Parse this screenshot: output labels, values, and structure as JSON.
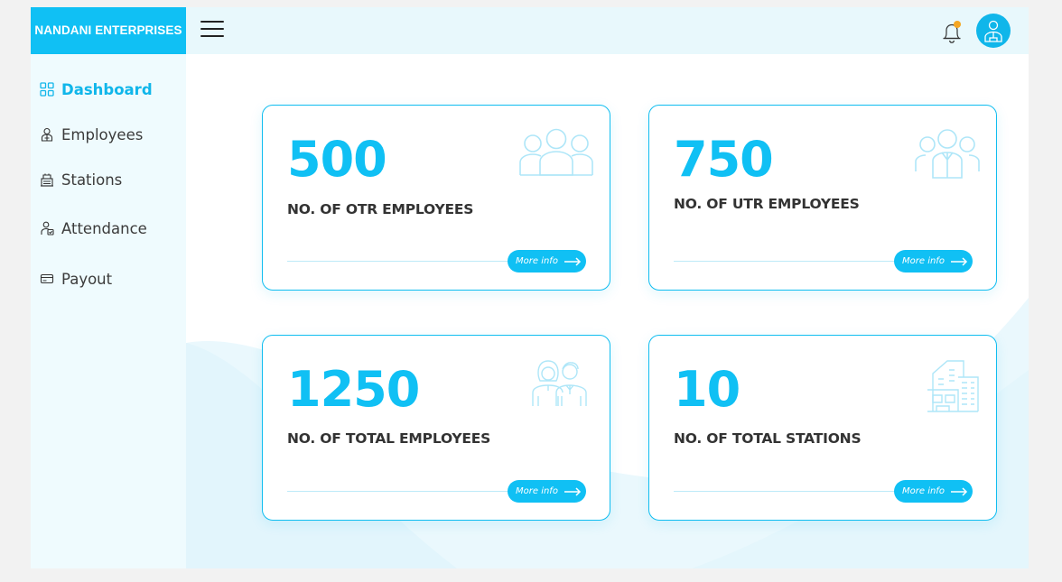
{
  "brand": {
    "name": "NANDANI ENTERPRISES"
  },
  "sidebar": {
    "items": [
      {
        "label": "Dashboard",
        "icon": "dashboard-grid-icon",
        "active": true
      },
      {
        "label": "Employees",
        "icon": "employee-icon",
        "active": false
      },
      {
        "label": "Stations",
        "icon": "station-icon",
        "active": false
      },
      {
        "label": "Attendance",
        "icon": "attendance-icon",
        "active": false
      },
      {
        "label": "Payout",
        "icon": "payout-card-icon",
        "active": false
      }
    ]
  },
  "header": {
    "menu_icon": "hamburger-menu-icon",
    "notification_icon": "bell-icon",
    "avatar_icon": "user-avatar-icon"
  },
  "cards": [
    {
      "value": "500",
      "label": "NO. OF OTR EMPLOYEES",
      "more": "More info",
      "icon": "group-people-icon"
    },
    {
      "value": "750",
      "label": "NO. OF UTR EMPLOYEES",
      "more": "More info",
      "icon": "group-people-icon"
    },
    {
      "value": "1250",
      "label": "NO. OF TOTAL EMPLOYEES",
      "more": "More info",
      "icon": "two-people-icon"
    },
    {
      "value": "10",
      "label": "NO. OF TOTAL STATIONS",
      "more": "More info",
      "icon": "building-icon"
    }
  ],
  "colors": {
    "accent": "#10c0f4",
    "sidebar_bg": "#effbfe",
    "topbar_bg": "#e8f8fc",
    "badge": "#f5a623"
  }
}
